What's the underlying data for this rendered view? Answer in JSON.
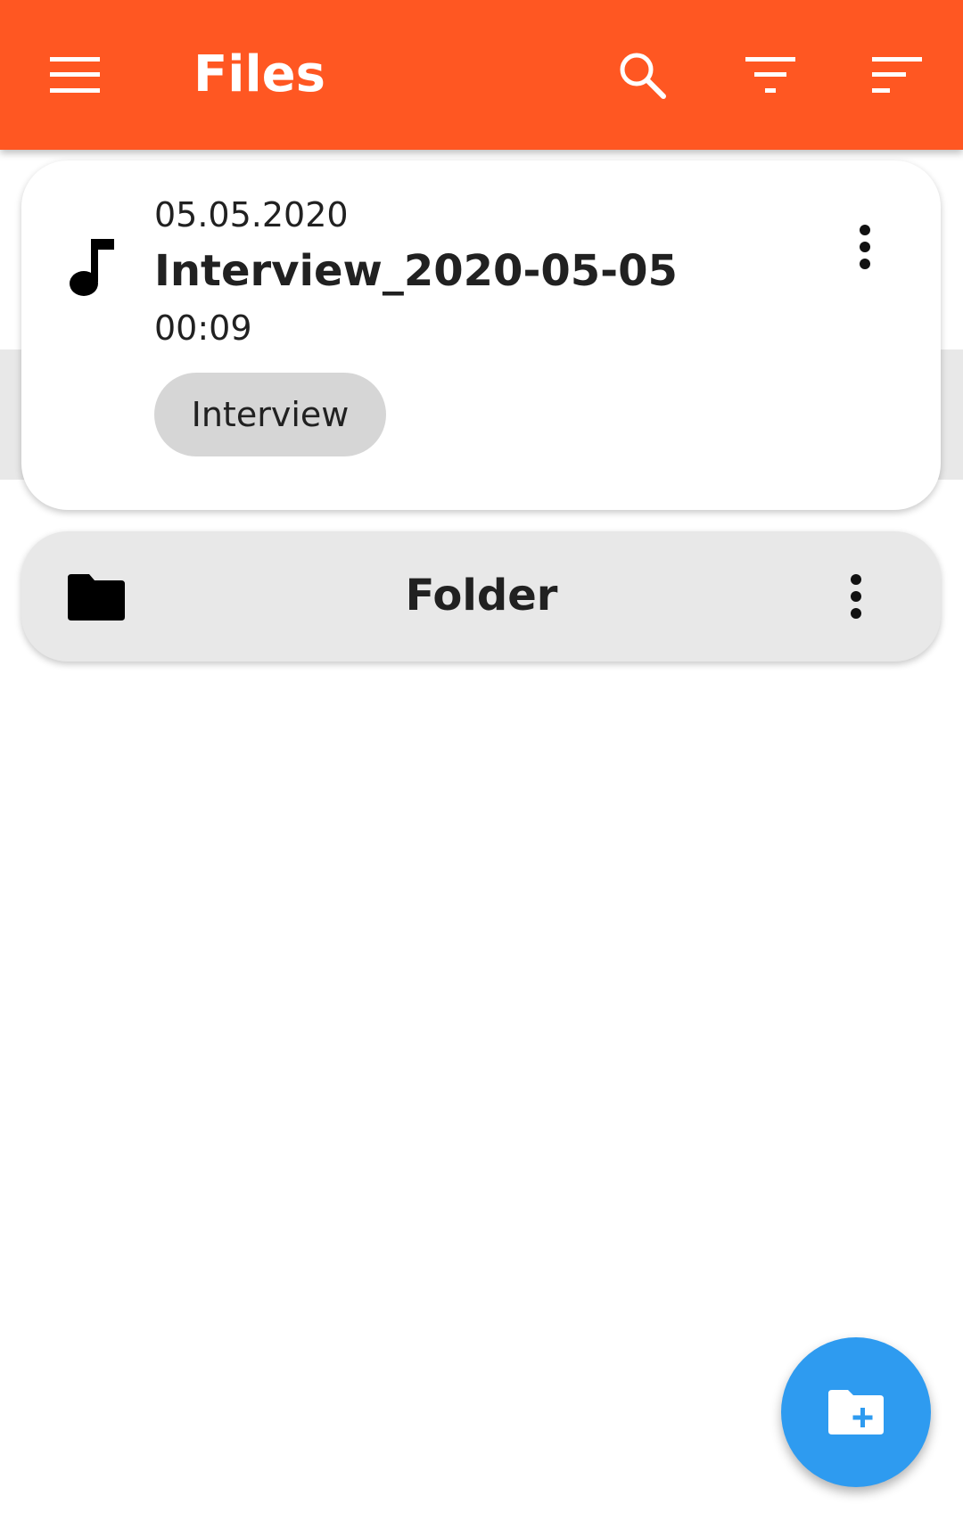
{
  "app_bar": {
    "title": "Files",
    "background_color": "#FF5722",
    "actions": [
      {
        "icon": "menu-icon"
      },
      {
        "icon": "search-icon"
      },
      {
        "icon": "filter-icon"
      },
      {
        "icon": "sort-icon"
      }
    ]
  },
  "items": [
    {
      "kind": "file",
      "icon": "music-note-icon",
      "date": "05.05.2020",
      "name": "Interview_2020-05-05",
      "duration": "00:09",
      "tag": "Interview",
      "more_icon": "more-vert-icon"
    },
    {
      "kind": "folder",
      "icon": "folder-icon",
      "name": "Folder",
      "more_icon": "more-vert-icon"
    }
  ],
  "fab": {
    "icon": "create-new-folder-icon",
    "color": "#2E9BF0"
  }
}
